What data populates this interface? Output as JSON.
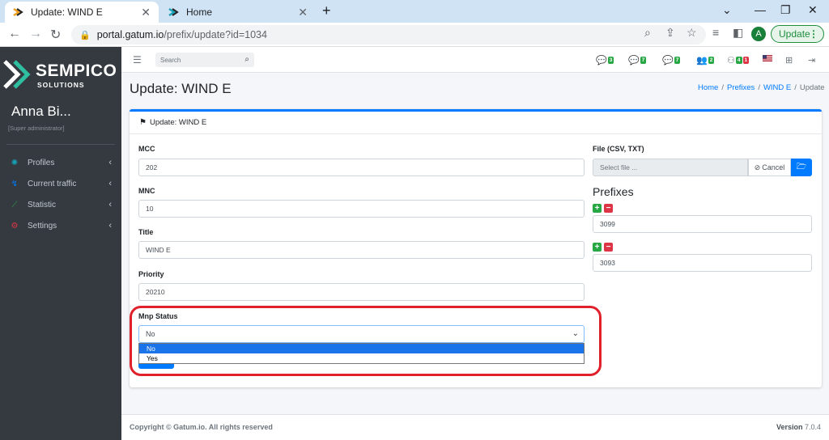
{
  "browser": {
    "tabs": [
      {
        "title": "Update: WIND E",
        "close": "✕"
      },
      {
        "title": "Home",
        "close": "✕"
      }
    ],
    "new_tab": "+",
    "url_host": "portal.gatum.io",
    "url_path": "/prefix/update?id=1034",
    "profile_initial": "A",
    "update_label": "Update"
  },
  "sidebar": {
    "logo_name": "SEMPICO",
    "logo_sub": "SOLUTIONS",
    "user_name": "Anna Bi...",
    "user_role": "[Super administrator]",
    "items": [
      {
        "label": "Profiles"
      },
      {
        "label": "Current traffic"
      },
      {
        "label": "Statistic"
      },
      {
        "label": "Settings"
      }
    ]
  },
  "topnav": {
    "search_placeholder": "Search",
    "badges": [
      {
        "count": "3",
        "color": "#28a745"
      },
      {
        "count": "7",
        "color": "#28a745"
      },
      {
        "count": "7",
        "color": "#28a745"
      },
      {
        "count": "2",
        "color": "#28a745"
      },
      {
        "count": "4",
        "color": "#28a745"
      },
      {
        "count": "1",
        "color": "#dc3545"
      }
    ]
  },
  "page": {
    "title": "Update: WIND E",
    "breadcrumb": [
      "Home",
      "Prefixes",
      "WIND E",
      "Update"
    ],
    "breadcrumb_sep": "/"
  },
  "card": {
    "header": "Update: WIND E"
  },
  "form": {
    "mcc_label": "MCC",
    "mcc_value": "202",
    "mnc_label": "MNC",
    "mnc_value": "10",
    "title_label": "Title",
    "title_value": "WIND E",
    "priority_label": "Priority",
    "priority_value": "20210",
    "mnp_label": "Mnp Status",
    "mnp_value": "No",
    "mnp_options": [
      {
        "label": "No",
        "selected": true
      },
      {
        "label": "Yes",
        "selected": false
      }
    ],
    "file_label": "File (CSV, TXT)",
    "file_placeholder": "Select file ...",
    "file_cancel": "Cancel",
    "prefixes_title": "Prefixes",
    "prefixes": [
      "3099",
      "3093"
    ]
  },
  "footer": {
    "copyright": "Copyright © Gatum.io. All rights reserved",
    "version_label": "Version",
    "version_value": "7.0.4"
  },
  "colors": {
    "accent": "#007bff",
    "sidebar": "#343a40",
    "highlight": "#e0202a"
  }
}
